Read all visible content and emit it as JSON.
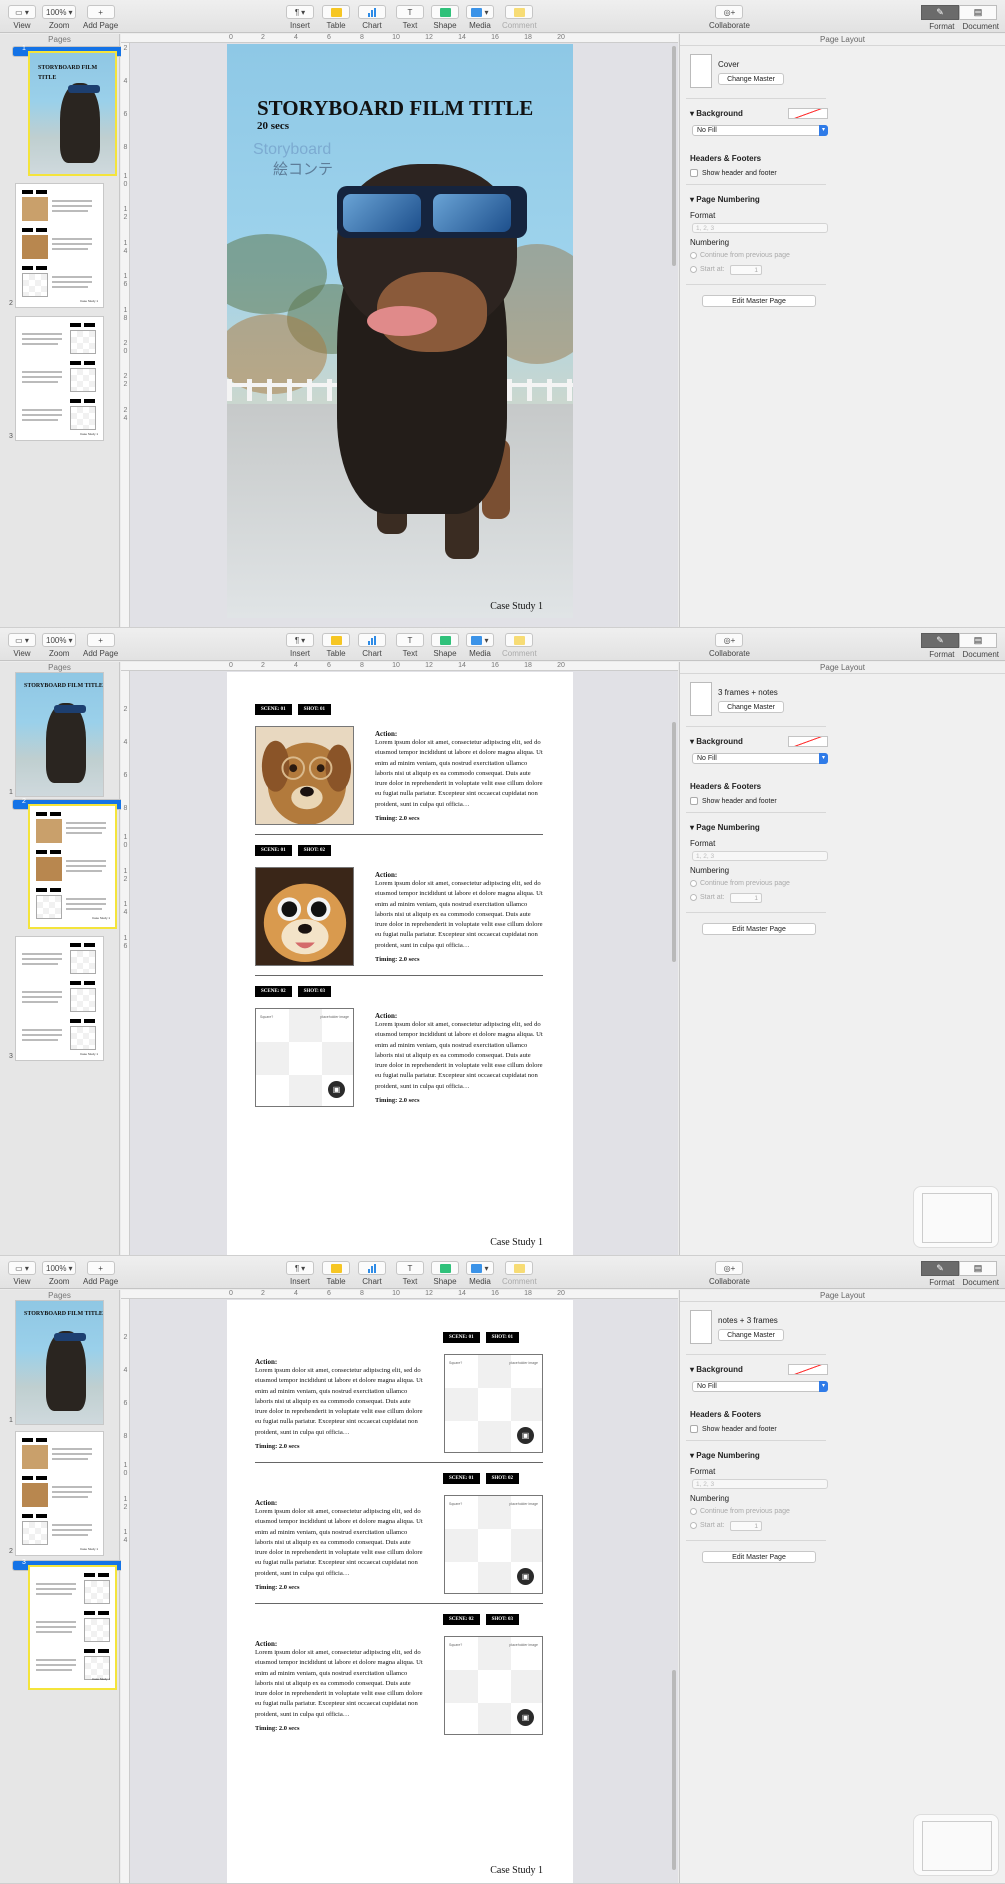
{
  "toolbar": {
    "view": "View",
    "zoom_value": "100%",
    "zoom": "Zoom",
    "add_page": "Add Page",
    "insert": "Insert",
    "table": "Table",
    "chart": "Chart",
    "text": "Text",
    "shape": "Shape",
    "media": "Media",
    "comment": "Comment",
    "collaborate": "Collaborate",
    "format": "Format",
    "document": "Document",
    "insert_glyph": "¶",
    "text_glyph": "T"
  },
  "sidebar": {
    "title": "Pages",
    "pages": [
      "1",
      "2",
      "3"
    ]
  },
  "ruler": {
    "h": [
      "0",
      "2",
      "4",
      "6",
      "8",
      "10",
      "12",
      "14",
      "16",
      "18",
      "20"
    ],
    "v": [
      "2",
      "4",
      "6",
      "8",
      "1",
      "0",
      "1",
      "2",
      "1",
      "4",
      "1",
      "6",
      "1",
      "8",
      "2",
      "0",
      "2",
      "2",
      "2",
      "4",
      "2",
      "6",
      "2",
      "8"
    ]
  },
  "cover": {
    "title": "STORYBOARD FILM TITLE",
    "subtitle": "20 secs",
    "tagline_en": "Storyboard",
    "tagline_jp": "絵コンテ",
    "footer": "Case Study 1"
  },
  "thumb": {
    "title": "STORYBOARD FILM TITLE",
    "sub": "Story",
    "footer": "Case Study 1"
  },
  "frames": [
    {
      "scene": "SCENE: 01",
      "shot": "SHOT: 01"
    },
    {
      "scene": "SCENE: 01",
      "shot": "SHOT: 02"
    },
    {
      "scene": "SCENE: 02",
      "shot": "SHOT: 03"
    }
  ],
  "frames_p3": [
    {
      "scene": "SCENE: 01",
      "shot": "SHOT: 01"
    },
    {
      "scene": "SCENE: 01",
      "shot": "SHOT: 02"
    },
    {
      "scene": "SCENE: 02",
      "shot": "SHOT: 03"
    }
  ],
  "notes": {
    "action": "Action:",
    "body": "Lorem ipsum dolor sit amet, consectetur adipiscing elit, sed do eiusmod tempor incididunt ut labore et dolore magna aliqua. Ut enim ad minim veniam, quis nostrud exercitation ullamco laboris nisi ut aliquip ex ea commodo consequat. Duis aute irure dolor in reprehenderit in voluptate velit esse cillum dolore eu fugiat nulla pariatur. Excepteur sint occaecat cupidatat non proident, sunt in culpa qui officia…",
    "timing": "Timing: 2.0 secs",
    "placeholder_left": "Square?",
    "placeholder_right": "placeholder image"
  },
  "inspector": {
    "title": "Page Layout",
    "masters": [
      "Cover",
      "3 frames + notes",
      "notes + 3 frames"
    ],
    "change_master": "Change Master",
    "background": "Background",
    "fill": "No Fill",
    "headers_footers": "Headers & Footers",
    "show_header_footer": "Show header and footer",
    "page_numbering": "Page Numbering",
    "format": "Format",
    "format_value": "1, 2, 3",
    "numbering": "Numbering",
    "continue": "Continue from previous page",
    "start_at": "Start at:",
    "start_value": "1",
    "edit_master": "Edit Master Page"
  }
}
